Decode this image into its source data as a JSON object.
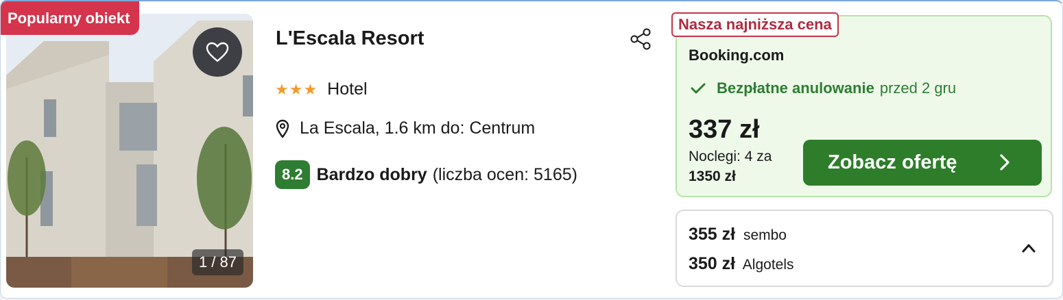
{
  "badge": {
    "popular": "Popularny obiekt"
  },
  "gallery": {
    "counter": "1 / 87"
  },
  "hotel": {
    "name": "L'Escala Resort",
    "stars": "★★★",
    "type": "Hotel",
    "location": "La Escala, 1.6 km do: Centrum",
    "rating_score": "8.2",
    "rating_label": "Bardzo dobry",
    "rating_count": "(liczba ocen: 5165)"
  },
  "best_offer": {
    "tag": "Nasza najniższa cena",
    "provider": "Booking.com",
    "cancellation_strong": "Bezpłatne anulowanie",
    "cancellation_rest": "przed 2 gru",
    "price": "337 zł",
    "nights_label": "Noclegi: 4 za",
    "nights_total": "1350 zł",
    "cta_label": "Zobacz ofertę"
  },
  "other_offers": [
    {
      "price": "355 zł",
      "provider": "sembo"
    },
    {
      "price": "350 zł",
      "provider": "Algotels"
    }
  ],
  "colors": {
    "popular_badge": "#d4354c",
    "rating_green": "#2e7d32",
    "cta_green": "#2e7d2a",
    "stars": "#f39a2c",
    "best_offer_bg": "#eef9ea"
  },
  "icons": [
    "heart-icon",
    "share-icon",
    "location-pin-icon",
    "check-icon",
    "chevron-right-icon",
    "chevron-up-icon"
  ]
}
